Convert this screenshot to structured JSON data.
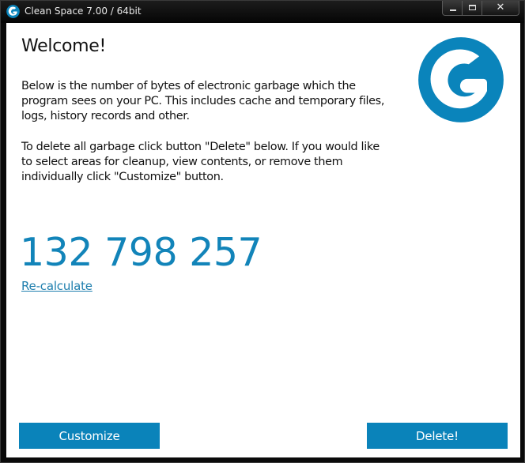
{
  "window": {
    "title": "Clean Space 7.00 / 64bit",
    "close_glyph": "✕"
  },
  "main": {
    "heading": "Welcome!",
    "description": "Below is the number of bytes of electronic garbage which the program sees on your PC. This includes cache and temporary files, logs, history records and other.",
    "instructions": "To delete all garbage click button \"Delete\" below. If you would like to select areas for cleanup, view contents, or remove them individually click \"Customize\" button.",
    "garbage_bytes": "132 798 257",
    "recalculate_link": "Re-calculate"
  },
  "buttons": {
    "customize_label": "Customize",
    "delete_label": "Delete!"
  },
  "icons": {
    "app": "clean-space-logo-icon",
    "logo": "clean-space-logo-icon"
  },
  "colors": {
    "accent": "#0a83ba",
    "bytes_text": "#1284b9",
    "link": "#1f7fae",
    "logo": "#0a84bb"
  }
}
